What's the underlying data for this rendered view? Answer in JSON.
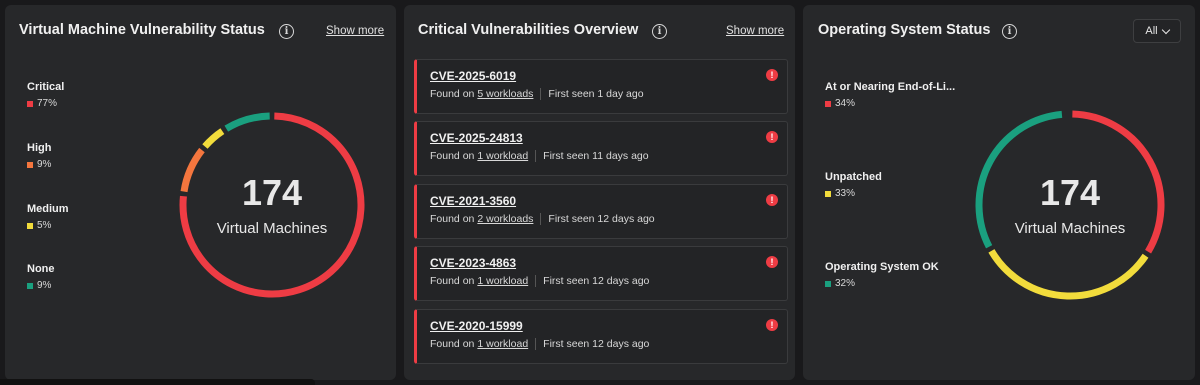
{
  "vm_panel": {
    "title": "Virtual Machine Vulnerability Status",
    "show_more": "Show more",
    "info_icon": "i",
    "count": "174",
    "count_label": "Virtual Machines",
    "legend": [
      {
        "name": "Critical",
        "value": "77%",
        "color": "#ee3c44",
        "fraction": 0.77
      },
      {
        "name": "High",
        "value": "9%",
        "color": "#f4763e",
        "fraction": 0.09
      },
      {
        "name": "Medium",
        "value": "5%",
        "color": "#f2dc3c",
        "fraction": 0.05
      },
      {
        "name": "None",
        "value": "9%",
        "color": "#1aa07f",
        "fraction": 0.09
      }
    ]
  },
  "cve_panel": {
    "title": "Critical Vulnerabilities Overview",
    "show_more": "Show more",
    "info_icon": "i",
    "found_on_label": "Found on",
    "items": [
      {
        "id": "CVE-2025-6019",
        "workloads": "5 workloads",
        "first_seen": "First seen 1 day ago"
      },
      {
        "id": "CVE-2025-24813",
        "workloads": "1 workload",
        "first_seen": "First seen 11 days ago"
      },
      {
        "id": "CVE-2021-3560",
        "workloads": "2 workloads",
        "first_seen": "First seen 12 days ago"
      },
      {
        "id": "CVE-2023-4863",
        "workloads": "1 workload",
        "first_seen": "First seen 12 days ago"
      },
      {
        "id": "CVE-2020-15999",
        "workloads": "1 workload",
        "first_seen": "First seen 12 days ago"
      }
    ],
    "alert_icon": "!"
  },
  "os_panel": {
    "title": "Operating System Status",
    "info_icon": "i",
    "filter_value": "All",
    "count": "174",
    "count_label": "Virtual Machines",
    "legend": [
      {
        "name": "At or Nearing End-of-Li...",
        "value": "34%",
        "color": "#ee3c44",
        "fraction": 0.34
      },
      {
        "name": "Unpatched",
        "value": "33%",
        "color": "#f2dc3c",
        "fraction": 0.33
      },
      {
        "name": "Operating System OK",
        "value": "32%",
        "color": "#1aa07f",
        "fraction": 0.32
      }
    ]
  }
}
